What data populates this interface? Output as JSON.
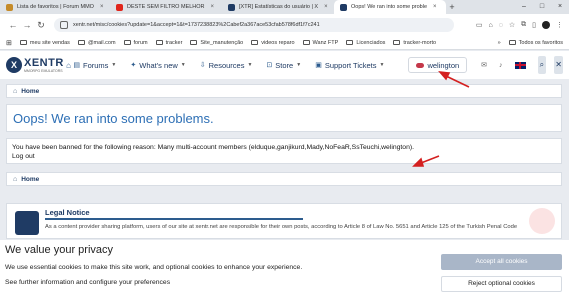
{
  "browser": {
    "tabs": [
      {
        "label": "Lista de favoritos | Forum MMO",
        "favicon_color": "#c58b2a",
        "active": false
      },
      {
        "label": "DESTE SEM FILTRO MELHOR",
        "favicon_color": "#e0261c",
        "active": false
      },
      {
        "label": "[XTR] Estatísticas do usuário | X",
        "favicon_color": "#1f3b64",
        "active": false
      },
      {
        "label": "Oops! We ran into some proble",
        "favicon_color": "#1f3b64",
        "active": true
      }
    ],
    "url": "xentr.net/misc/cookies?update=1&accept=1&t=1737238823%2Cabef2a367ace53cfab578f6df1f7c241",
    "bookmarks": [
      "meu site vendas",
      "@mail.com",
      "forum",
      "tracker",
      "Site_manutenção",
      "videos reparo",
      "Wanz FTP",
      "Licenciados",
      "tracker-morto"
    ],
    "bookmarks_right": "Todos os favoritos"
  },
  "site": {
    "logo_text": "XENTR",
    "logo_sub": "MMORPG EMULATORS",
    "menu": [
      {
        "label": "Forums",
        "icon": "comments-icon"
      },
      {
        "label": "What's new",
        "icon": "bolt-icon"
      },
      {
        "label": "Resources",
        "icon": "download-icon"
      },
      {
        "label": "Store",
        "icon": "cart-icon"
      },
      {
        "label": "Support Tickets",
        "icon": "ticket-icon"
      }
    ],
    "username": "welington"
  },
  "content": {
    "breadcrumb_top": "Home",
    "error_title": "Oops! We ran into some problems.",
    "ban_message": "You have been banned for the following reason: Many multi-account members (elduque,ganjikurd,Mady,NoFeaR,SsTeuchi,welington).",
    "logout_label": "Log out",
    "breadcrumb_bottom": "Home",
    "legal_title": "Legal Notice",
    "legal_text": "As a content provider sharing platform, users of our site at xentr.net are responsible for their own posts, according to Article 8 of Law No. 5651 and Article 125 of the Turkish Penal Code"
  },
  "cookie_banner": {
    "title": "We value your privacy",
    "text": "We use essential cookies to make this site work, and optional cookies to enhance your experience.",
    "link": "See further information and configure your preferences",
    "accept_label": "Accept all cookies",
    "reject_label": "Reject optional cookies"
  },
  "colors": {
    "brand": "#1f3b64",
    "link_blue": "#2d6fb5",
    "annotation_red": "#d42020"
  }
}
